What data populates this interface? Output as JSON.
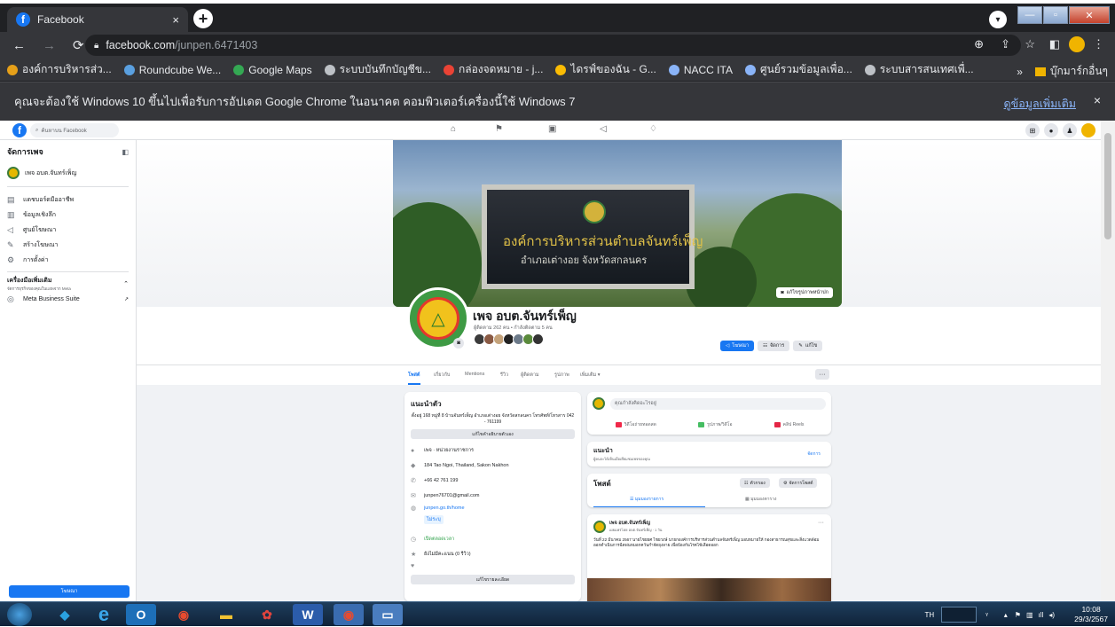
{
  "browser": {
    "tab_title": "Facebook",
    "tab_close": "×",
    "new_tab": "+",
    "url_host": "facebook.com",
    "url_path": "/junpen.6471403",
    "bookmarks": [
      {
        "label": "องค์การบริหารส่ว...",
        "color": "#e6a019"
      },
      {
        "label": "Roundcube We...",
        "color": "#5aa0e0"
      },
      {
        "label": "Google Maps",
        "color": "#34a853"
      },
      {
        "label": "ระบบบันทึกบัญชีข...",
        "color": "#bdc1c6"
      },
      {
        "label": "กล่องจดหมาย - j...",
        "color": "#ea4335"
      },
      {
        "label": "ไดรฟ์ของฉัน - G...",
        "color": "#fbbc04"
      },
      {
        "label": "NACC ITA",
        "color": "#8ab4f8"
      },
      {
        "label": "ศูนย์รวมข้อมูลเพื่อ...",
        "color": "#8ab4f8"
      },
      {
        "label": "ระบบสารสนเทศเพื่...",
        "color": "#bdc1c6"
      }
    ],
    "bookmarks_more": "»",
    "other_bookmarks": "บุ๊กมาร์กอื่นๆ",
    "infobar_text": "คุณจะต้องใช้ Windows 10 ขึ้นไปเพื่อรับการอัปเดต Google Chrome ในอนาคต คอมพิวเตอร์เครื่องนี้ใช้ Windows 7",
    "infobar_link": "ดูข้อมูลเพิ่มเติม",
    "infobar_close": "×"
  },
  "facebook": {
    "search_placeholder": "ค้นหาบน Facebook",
    "sidebar": {
      "title": "จัดการเพจ",
      "page_name": "เพจ อบต.จันทร์เพ็ญ",
      "items": [
        {
          "label": "แดชบอร์ดมืออาชีพ",
          "icon": "dashboard-icon"
        },
        {
          "label": "ข้อมูลเชิงลึก",
          "icon": "insights-icon"
        },
        {
          "label": "ศูนย์โฆษณา",
          "icon": "megaphone-icon"
        },
        {
          "label": "สร้างโฆษณา",
          "icon": "edit-icon"
        },
        {
          "label": "การตั้งค่า",
          "icon": "gear-icon"
        }
      ],
      "tools_title": "เครื่องมือเพิ่มเติม",
      "tools_sub": "จัดการธุรกิจของคุณในแอพจาก Meta",
      "meta_suite": "Meta Business Suite",
      "promote_button": "โฆษณา"
    },
    "cover": {
      "sign_line1": "องค์การบริหารส่วนตำบลจันทร์เพ็ญ",
      "sign_line2": "อำเภอเต่างอย จังหวัดสกลนคร",
      "edit_cover": "แก้ไขรูปภาพหน้าปก"
    },
    "profile": {
      "name": "เพจ อบต.จันทร์เพ็ญ",
      "stats": "ผู้ติดตาม 262 คน • กำลังติดตาม 5 คน",
      "btn_promote": "โฆษณา",
      "btn_manage": "จัดการ",
      "btn_edit": "แก้ไข"
    },
    "tabs": [
      "โพสต์",
      "เกี่ยวกับ",
      "Mentions",
      "รีวิว",
      "ผู้ติดตาม",
      "รูปภาพ",
      "เพิ่มเติม ▾"
    ],
    "tabs_more": "···",
    "intro": {
      "title": "แนะนำตัว",
      "description": "ตั้งอยู่ 168 หมู่ที่ 8 บ้านจันทร์เพ็ญ อำเภอเต่างอย จังหวัดสกลนคร โทรศัพท์/โทรสาร 042 - 761199",
      "edit_bio": "แก้ไขคำอธิบายตัวเอง",
      "category": "เพจ · หน่วยงานราชการ",
      "address": "184 Tao Ngoi, Thailand, Sakon Nakhon",
      "phone": "+66 42 761 199",
      "email": "junpen76701@gmail.com",
      "website": "junpen.go.th/home",
      "whatsapp": "ไม่ระบุ",
      "hours": "เปิดตลอดเวลา",
      "rating": "ยังไม่มีคะแนน (0 รีวิว)",
      "edit_details": "แก้ไขรายละเอียด"
    },
    "composer": {
      "placeholder": "คุณกำลังคิดอะไรอยู่",
      "live": "วิดีโอถ่ายทอดสด",
      "photo": "รูปภาพ/วิดีโอ",
      "reel": "คลิป Reels"
    },
    "recommend": {
      "title": "แนะนำ",
      "sub": "ผู้คนจะได้เห็นเมื่อเยี่ยมชมเพจของคุณ",
      "manage": "จัดการ"
    },
    "posts": {
      "title": "โพสต์",
      "filter": "ตัวกรอง",
      "manage": "จัดการโพสต์",
      "list_view": "มุมมองรายการ",
      "grid_view": "มุมมองตาราง"
    },
    "post": {
      "author": "เพจ อบต.จันทร์เพ็ญ",
      "meta": "เผยแพร่โดย อบต.จันทร์เพ็ญ · 1 วัน",
      "text": "วันที่ 22 มีนาคม 2567 นายไชยยศ ไชยวงษ์ นายกองค์การบริหารส่วนตำบลจันทร์เพ็ญ มอบหมายให้ กองสาธารณสุขและสิ่งแวดล้อม ออกดำเนินการฉีดพ่นหมอกควันกำจัดยุงลาย เพื่อป้องกันโรคไข้เลือดออก"
    }
  },
  "taskbar": {
    "lang": "TH",
    "time": "10:08",
    "date": "29/3/2567"
  }
}
